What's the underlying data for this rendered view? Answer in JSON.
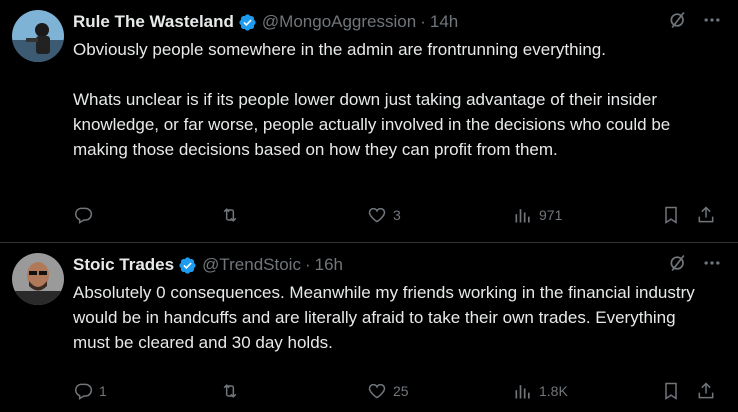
{
  "colors": {
    "background": "#000000",
    "text": "#e7e9ea",
    "muted": "#71767b",
    "verified": "#1d9bf0",
    "divider": "#2f3336"
  },
  "tweets": [
    {
      "name": "Rule The Wasteland",
      "handle": "@MongoAggression",
      "separator": "·",
      "time": "14h",
      "paragraphs": [
        "Obviously people somewhere in the admin are frontrunning everything.",
        "Whats unclear is if its people lower down just taking advantage of their insider knowledge, or far worse, people actually involved in the decisions who could be making those decisions based on how they can profit from them."
      ],
      "replies": "",
      "retweets": "",
      "likes": "3",
      "views": "971"
    },
    {
      "name": "Stoic Trades",
      "handle": "@TrendStoic",
      "separator": "·",
      "time": "16h",
      "paragraphs": [
        "Absolutely 0 consequences. Meanwhile my friends working in the financial industry would be in handcuffs and are literally afraid to take their own trades. Everything must be cleared and 30 day holds."
      ],
      "replies": "1",
      "retweets": "",
      "likes": "25",
      "views": "1.8K"
    }
  ],
  "icons": {
    "verified": "verified-badge-icon",
    "grok": "grok-icon",
    "more": "more-icon",
    "reply": "reply-icon",
    "retweet": "retweet-icon",
    "like": "heart-icon",
    "views": "views-icon",
    "bookmark": "bookmark-icon",
    "share": "share-icon"
  }
}
